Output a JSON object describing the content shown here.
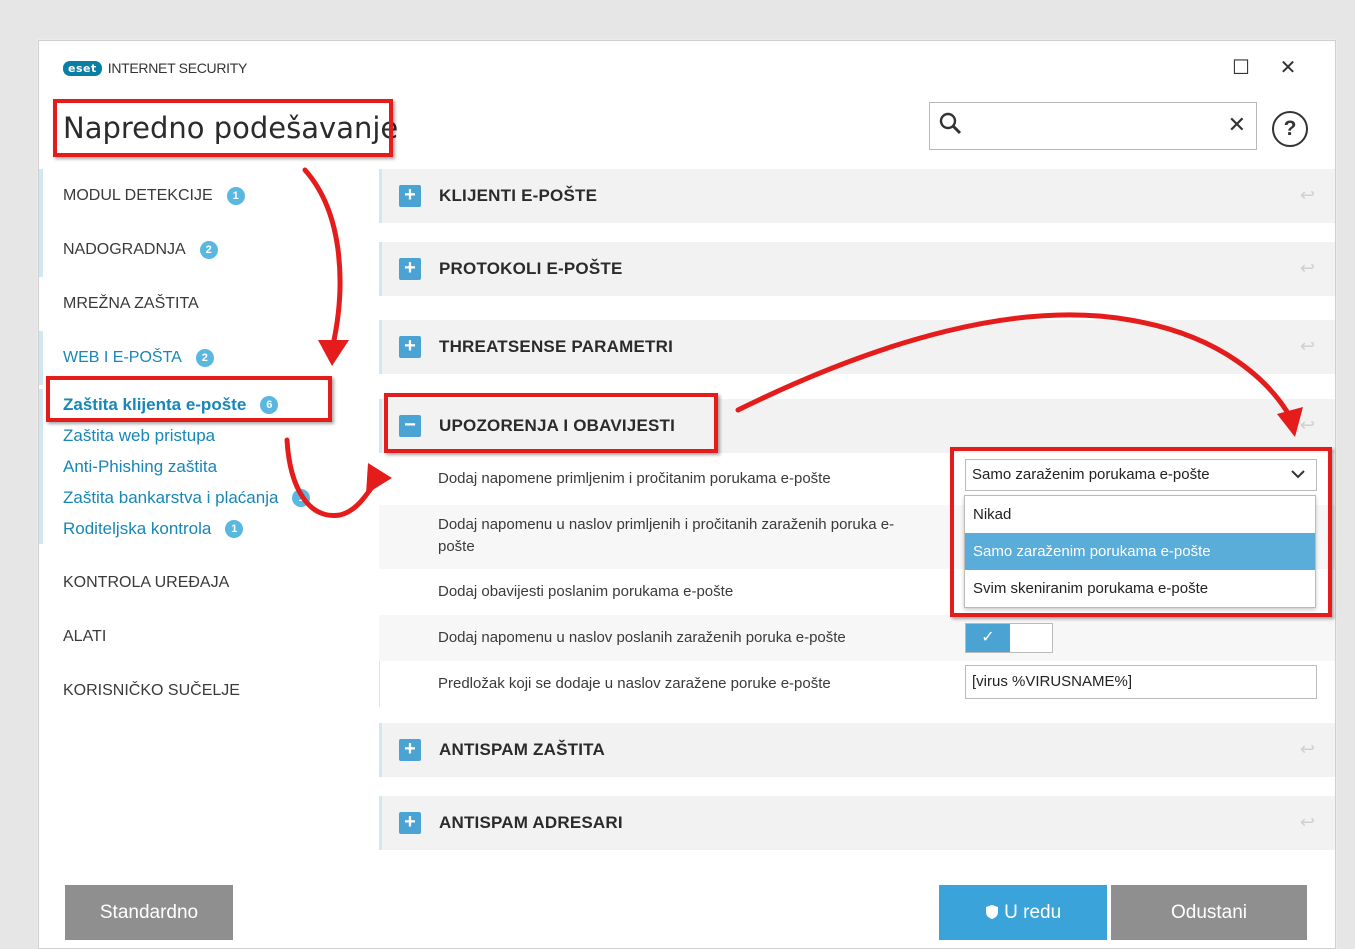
{
  "app": {
    "logo_text": "eset",
    "product_name": "INTERNET SECURITY",
    "page_title": "Napredno podešavanje",
    "maximize_glyph": "☐",
    "close_glyph": "✕"
  },
  "search": {
    "value": "",
    "placeholder": "",
    "clear_glyph": "✕"
  },
  "help_glyph": "?",
  "sidebar": {
    "items": [
      {
        "label": "MODUL DETEKCIJE",
        "badge": "1"
      },
      {
        "label": "NADOGRADNJA",
        "badge": "2"
      },
      {
        "label": "MREŽNA ZAŠTITA"
      },
      {
        "label": "WEB I E-POŠTA",
        "badge": "2"
      }
    ],
    "sub_items": [
      {
        "label": "Zaštita klijenta e-pošte",
        "badge": "6"
      },
      {
        "label": "Zaštita web pristupa"
      },
      {
        "label": "Anti-Phishing zaštita"
      },
      {
        "label": "Zaštita bankarstva i plaćanja",
        "badge": "1"
      },
      {
        "label": "Roditeljska kontrola",
        "badge": "1"
      }
    ],
    "bottom_items": [
      {
        "label": "KONTROLA UREĐAJA"
      },
      {
        "label": "ALATI"
      },
      {
        "label": "KORISNIČKO SUČELJE"
      }
    ]
  },
  "sections": [
    {
      "title": "KLIJENTI E-POŠTE",
      "icon": "+"
    },
    {
      "title": "PROTOKOLI E-POŠTE",
      "icon": "+"
    },
    {
      "title": "THREATSENSE PARAMETRI",
      "icon": "+"
    },
    {
      "title": "UPOZORENJA I OBAVIJESTI",
      "icon": "−"
    },
    {
      "title": "ANTISPAM ZAŠTITA",
      "icon": "+"
    },
    {
      "title": "ANTISPAM ADRESARI",
      "icon": "+"
    }
  ],
  "settings": {
    "s1": {
      "label": "Dodaj napomene primljenim i pročitanim porukama e-pošte",
      "value": "Samo zaraženim porukama e-pošte"
    },
    "s2": {
      "label": "Dodaj napomenu u naslov primljenih i pročitanih zaraženih poruka e-pošte"
    },
    "s3": {
      "label": "Dodaj obavijesti poslanim porukama e-pošte"
    },
    "s4": {
      "label": "Dodaj napomenu u naslov poslanih zaraženih poruka e-pošte",
      "toggle": "✓"
    },
    "s5": {
      "label": "Predložak koji se dodaje u naslov zaražene poruke e-pošte",
      "value": "[virus %VIRUSNAME%]"
    }
  },
  "dropdown_options": [
    "Nikad",
    "Samo zaraženim porukama e-pošte",
    "Svim skeniranim porukama e-pošte"
  ],
  "buttons": {
    "default": "Standardno",
    "ok": "U redu",
    "cancel": "Odustani"
  },
  "colors": {
    "accent": "#3aa3da",
    "highlight_red": "#e41c1c"
  }
}
